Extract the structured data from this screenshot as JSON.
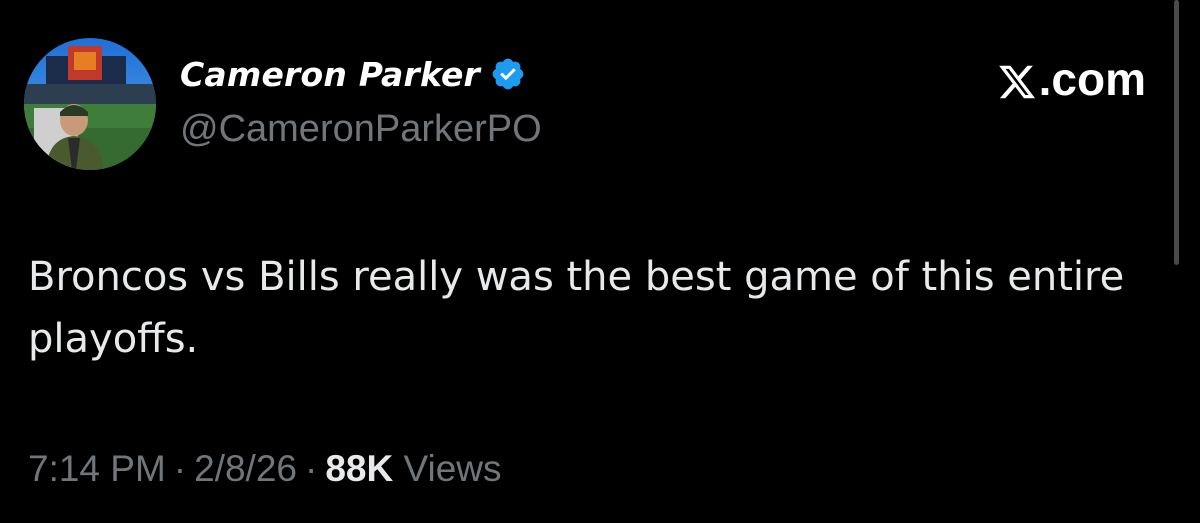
{
  "author": {
    "display_name": "Cameron Parker",
    "handle": "@CameronParkerPO",
    "verified_icon": "verified-badge-icon",
    "avatar_icon": "avatar-photo"
  },
  "brand": {
    "label": ".com",
    "icon": "x-logo-icon"
  },
  "tweet": {
    "text": "Broncos vs Bills really was the best game of this entire playoffs."
  },
  "meta": {
    "time": "7:14 PM",
    "separator": "·",
    "date": "2/8/26",
    "views_count": "88K",
    "views_label": "Views"
  },
  "colors": {
    "background": "#000000",
    "primary_text": "#e7e9ea",
    "secondary_text": "#71767b",
    "verified": "#1d9bf0"
  }
}
